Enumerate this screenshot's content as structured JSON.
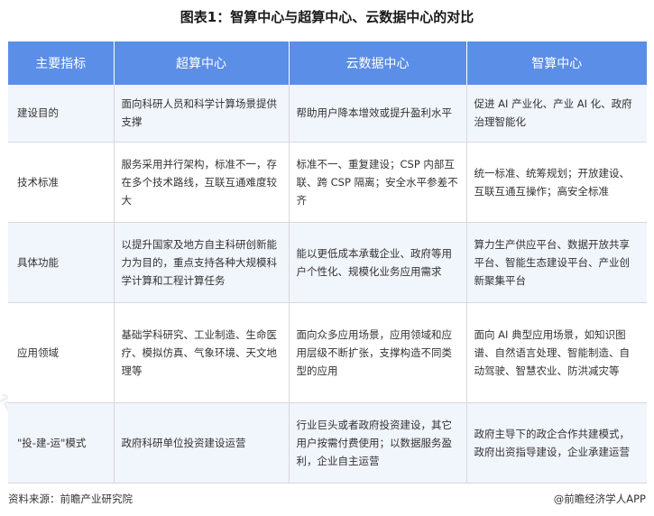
{
  "title": "图表1：智算中心与超算中心、云数据中心的对比",
  "table": {
    "headers": [
      "主要指标",
      "超算中心",
      "云数据中心",
      "智算中心"
    ],
    "rows": [
      {
        "label": "建设目的",
        "cells": [
          "面向科研人员和科学计算场景提供支撑",
          "帮助用户降本增效或提升盈利水平",
          "促进 AI 产业化、产业 AI 化、政府治理智能化"
        ]
      },
      {
        "label": "技术标准",
        "cells": [
          "服务采用并行架构，标准不一，存在多个技术路线，互联互通难度较大",
          "标准不一、重复建设；CSP 内部互联、跨 CSP 隔离；安全水平参差不齐",
          "统一标准、统筹规划；开放建设、互联互通互操作；高安全标准"
        ]
      },
      {
        "label": "具体功能",
        "cells": [
          "以提升国家及地方自主科研创新能力为目的，重点支持各种大规模科学计算和工程计算任务",
          "能以更低成本承载企业、政府等用户个性化、规模化业务应用需求",
          "算力生产供应平台、数据开放共享平台、智能生态建设平台、产业创新聚集平台"
        ]
      },
      {
        "label": "应用领域",
        "cells": [
          "基础学科研究、工业制造、生命医疗、模拟仿真、气象环境、天文地理等",
          "面向众多应用场景，应用领域和应用层级不断扩张，支撑构造不同类型的应用",
          "面向 AI 典型应用场景，如知识图谱、自然语言处理、智能制造、自动驾驶、智慧农业、防洪减灾等"
        ]
      },
      {
        "label": "\"投-建-运\"模式",
        "cells": [
          "政府科研单位投资建设运营",
          "行业巨头或者政府投资建设，其它用户按需付费使用；以数据服务盈利，企业自主运营",
          "政府主导下的政企合作共建模式，政府出资指导建设，企业承建运营"
        ]
      }
    ]
  },
  "source": "资料来源：前瞻产业研究院",
  "credit": "@前瞻经济学人APP",
  "watermark": "前瞻产业研究院",
  "colors": {
    "header_bg": "#5b8ee6",
    "stripe_bg": "#f1f5fc"
  }
}
